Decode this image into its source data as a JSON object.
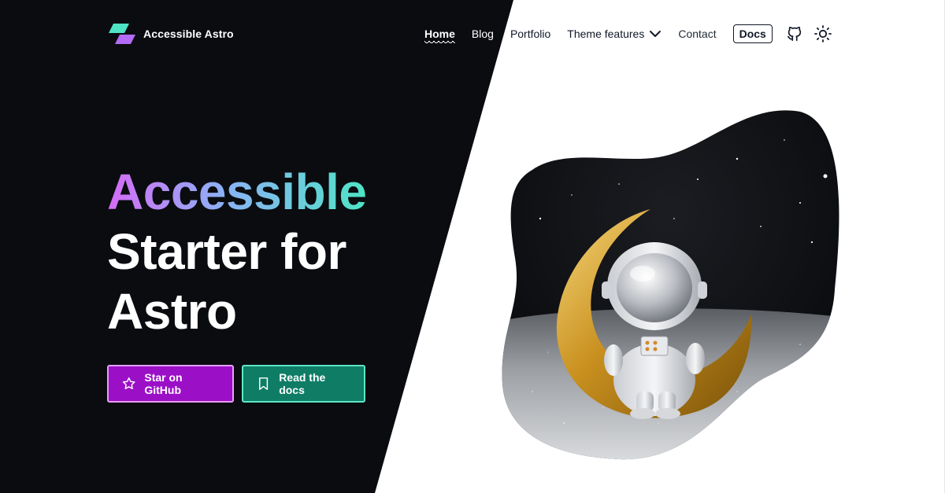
{
  "brand": {
    "name": "Accessible Astro",
    "logo_icon": "astro-parallelogram-logo-icon",
    "logo_colors": [
      "#4fe3c6",
      "#b36bf5"
    ]
  },
  "nav": {
    "items": [
      {
        "label": "Home",
        "active": true
      },
      {
        "label": "Blog"
      },
      {
        "label": "Portfolio"
      },
      {
        "label": "Theme features",
        "dropdown": true,
        "icon": "chevron-down-icon"
      },
      {
        "label": "Contact"
      }
    ],
    "docs_label": "Docs",
    "github_icon": "github-icon",
    "theme_toggle_icon": "sun-icon"
  },
  "hero": {
    "title_gradient": "Accessible",
    "title_line2": "Starter for",
    "title_line3": "Astro",
    "gradient_colors": [
      "#d66bf5",
      "#8bb2f5",
      "#4fe3c6"
    ]
  },
  "buttons": {
    "github": {
      "label": "Star on GitHub",
      "icon": "star-icon",
      "color": "#9b10c7"
    },
    "docs": {
      "label": "Read the docs",
      "icon": "bookmark-icon",
      "color": "#0f7d66"
    }
  },
  "illustration": {
    "subject": "astronaut-on-moon-illustration"
  },
  "colors": {
    "dark_bg": "#0a0c10",
    "light_bg": "#ffffff"
  }
}
